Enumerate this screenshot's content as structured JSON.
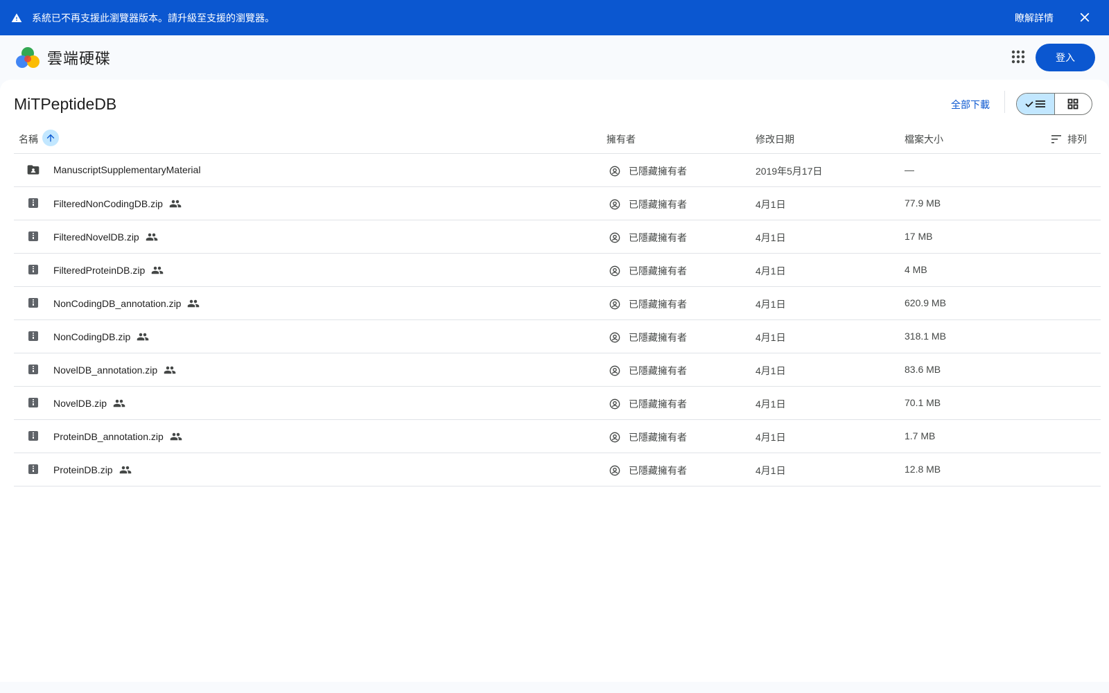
{
  "banner": {
    "message": "系統已不再支援此瀏覽器版本。請升級至支援的瀏覽器。",
    "learn_more": "瞭解詳情"
  },
  "header": {
    "app_name": "雲端硬碟",
    "sign_in": "登入"
  },
  "folder": {
    "title": "MiTPeptideDB",
    "download_all": "全部下載"
  },
  "columns": {
    "name": "名稱",
    "owner": "擁有者",
    "modified": "修改日期",
    "size": "檔案大小",
    "sort": "排列"
  },
  "files": [
    {
      "name": "ManuscriptSupplementaryMaterial",
      "type": "folder",
      "shared": false,
      "owner": "已隱藏擁有者",
      "modified": "2019年5月17日",
      "size": "—"
    },
    {
      "name": "FilteredNonCodingDB.zip",
      "type": "zip",
      "shared": true,
      "owner": "已隱藏擁有者",
      "modified": "4月1日",
      "size": "77.9 MB"
    },
    {
      "name": "FilteredNovelDB.zip",
      "type": "zip",
      "shared": true,
      "owner": "已隱藏擁有者",
      "modified": "4月1日",
      "size": "17 MB"
    },
    {
      "name": "FilteredProteinDB.zip",
      "type": "zip",
      "shared": true,
      "owner": "已隱藏擁有者",
      "modified": "4月1日",
      "size": "4 MB"
    },
    {
      "name": "NonCodingDB_annotation.zip",
      "type": "zip",
      "shared": true,
      "owner": "已隱藏擁有者",
      "modified": "4月1日",
      "size": "620.9 MB"
    },
    {
      "name": "NonCodingDB.zip",
      "type": "zip",
      "shared": true,
      "owner": "已隱藏擁有者",
      "modified": "4月1日",
      "size": "318.1 MB"
    },
    {
      "name": "NovelDB_annotation.zip",
      "type": "zip",
      "shared": true,
      "owner": "已隱藏擁有者",
      "modified": "4月1日",
      "size": "83.6 MB"
    },
    {
      "name": "NovelDB.zip",
      "type": "zip",
      "shared": true,
      "owner": "已隱藏擁有者",
      "modified": "4月1日",
      "size": "70.1 MB"
    },
    {
      "name": "ProteinDB_annotation.zip",
      "type": "zip",
      "shared": true,
      "owner": "已隱藏擁有者",
      "modified": "4月1日",
      "size": "1.7 MB"
    },
    {
      "name": "ProteinDB.zip",
      "type": "zip",
      "shared": true,
      "owner": "已隱藏擁有者",
      "modified": "4月1日",
      "size": "12.8 MB"
    }
  ],
  "colors": {
    "brand_blue": "#0b57d0",
    "selected_blue": "#c2e7ff",
    "background": "#f8fafd"
  }
}
